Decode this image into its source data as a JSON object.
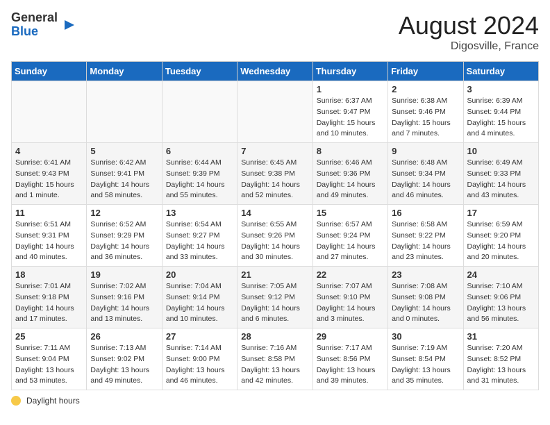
{
  "header": {
    "logo_general": "General",
    "logo_blue": "Blue",
    "title": "August 2024",
    "location": "Digosville, France"
  },
  "weekdays": [
    "Sunday",
    "Monday",
    "Tuesday",
    "Wednesday",
    "Thursday",
    "Friday",
    "Saturday"
  ],
  "weeks": [
    [
      {
        "day": "",
        "info": ""
      },
      {
        "day": "",
        "info": ""
      },
      {
        "day": "",
        "info": ""
      },
      {
        "day": "",
        "info": ""
      },
      {
        "day": "1",
        "info": "Sunrise: 6:37 AM\nSunset: 9:47 PM\nDaylight: 15 hours\nand 10 minutes."
      },
      {
        "day": "2",
        "info": "Sunrise: 6:38 AM\nSunset: 9:46 PM\nDaylight: 15 hours\nand 7 minutes."
      },
      {
        "day": "3",
        "info": "Sunrise: 6:39 AM\nSunset: 9:44 PM\nDaylight: 15 hours\nand 4 minutes."
      }
    ],
    [
      {
        "day": "4",
        "info": "Sunrise: 6:41 AM\nSunset: 9:43 PM\nDaylight: 15 hours\nand 1 minute."
      },
      {
        "day": "5",
        "info": "Sunrise: 6:42 AM\nSunset: 9:41 PM\nDaylight: 14 hours\nand 58 minutes."
      },
      {
        "day": "6",
        "info": "Sunrise: 6:44 AM\nSunset: 9:39 PM\nDaylight: 14 hours\nand 55 minutes."
      },
      {
        "day": "7",
        "info": "Sunrise: 6:45 AM\nSunset: 9:38 PM\nDaylight: 14 hours\nand 52 minutes."
      },
      {
        "day": "8",
        "info": "Sunrise: 6:46 AM\nSunset: 9:36 PM\nDaylight: 14 hours\nand 49 minutes."
      },
      {
        "day": "9",
        "info": "Sunrise: 6:48 AM\nSunset: 9:34 PM\nDaylight: 14 hours\nand 46 minutes."
      },
      {
        "day": "10",
        "info": "Sunrise: 6:49 AM\nSunset: 9:33 PM\nDaylight: 14 hours\nand 43 minutes."
      }
    ],
    [
      {
        "day": "11",
        "info": "Sunrise: 6:51 AM\nSunset: 9:31 PM\nDaylight: 14 hours\nand 40 minutes."
      },
      {
        "day": "12",
        "info": "Sunrise: 6:52 AM\nSunset: 9:29 PM\nDaylight: 14 hours\nand 36 minutes."
      },
      {
        "day": "13",
        "info": "Sunrise: 6:54 AM\nSunset: 9:27 PM\nDaylight: 14 hours\nand 33 minutes."
      },
      {
        "day": "14",
        "info": "Sunrise: 6:55 AM\nSunset: 9:26 PM\nDaylight: 14 hours\nand 30 minutes."
      },
      {
        "day": "15",
        "info": "Sunrise: 6:57 AM\nSunset: 9:24 PM\nDaylight: 14 hours\nand 27 minutes."
      },
      {
        "day": "16",
        "info": "Sunrise: 6:58 AM\nSunset: 9:22 PM\nDaylight: 14 hours\nand 23 minutes."
      },
      {
        "day": "17",
        "info": "Sunrise: 6:59 AM\nSunset: 9:20 PM\nDaylight: 14 hours\nand 20 minutes."
      }
    ],
    [
      {
        "day": "18",
        "info": "Sunrise: 7:01 AM\nSunset: 9:18 PM\nDaylight: 14 hours\nand 17 minutes."
      },
      {
        "day": "19",
        "info": "Sunrise: 7:02 AM\nSunset: 9:16 PM\nDaylight: 14 hours\nand 13 minutes."
      },
      {
        "day": "20",
        "info": "Sunrise: 7:04 AM\nSunset: 9:14 PM\nDaylight: 14 hours\nand 10 minutes."
      },
      {
        "day": "21",
        "info": "Sunrise: 7:05 AM\nSunset: 9:12 PM\nDaylight: 14 hours\nand 6 minutes."
      },
      {
        "day": "22",
        "info": "Sunrise: 7:07 AM\nSunset: 9:10 PM\nDaylight: 14 hours\nand 3 minutes."
      },
      {
        "day": "23",
        "info": "Sunrise: 7:08 AM\nSunset: 9:08 PM\nDaylight: 14 hours\nand 0 minutes."
      },
      {
        "day": "24",
        "info": "Sunrise: 7:10 AM\nSunset: 9:06 PM\nDaylight: 13 hours\nand 56 minutes."
      }
    ],
    [
      {
        "day": "25",
        "info": "Sunrise: 7:11 AM\nSunset: 9:04 PM\nDaylight: 13 hours\nand 53 minutes."
      },
      {
        "day": "26",
        "info": "Sunrise: 7:13 AM\nSunset: 9:02 PM\nDaylight: 13 hours\nand 49 minutes."
      },
      {
        "day": "27",
        "info": "Sunrise: 7:14 AM\nSunset: 9:00 PM\nDaylight: 13 hours\nand 46 minutes."
      },
      {
        "day": "28",
        "info": "Sunrise: 7:16 AM\nSunset: 8:58 PM\nDaylight: 13 hours\nand 42 minutes."
      },
      {
        "day": "29",
        "info": "Sunrise: 7:17 AM\nSunset: 8:56 PM\nDaylight: 13 hours\nand 39 minutes."
      },
      {
        "day": "30",
        "info": "Sunrise: 7:19 AM\nSunset: 8:54 PM\nDaylight: 13 hours\nand 35 minutes."
      },
      {
        "day": "31",
        "info": "Sunrise: 7:20 AM\nSunset: 8:52 PM\nDaylight: 13 hours\nand 31 minutes."
      }
    ]
  ],
  "footer": {
    "daylight_label": "Daylight hours"
  }
}
